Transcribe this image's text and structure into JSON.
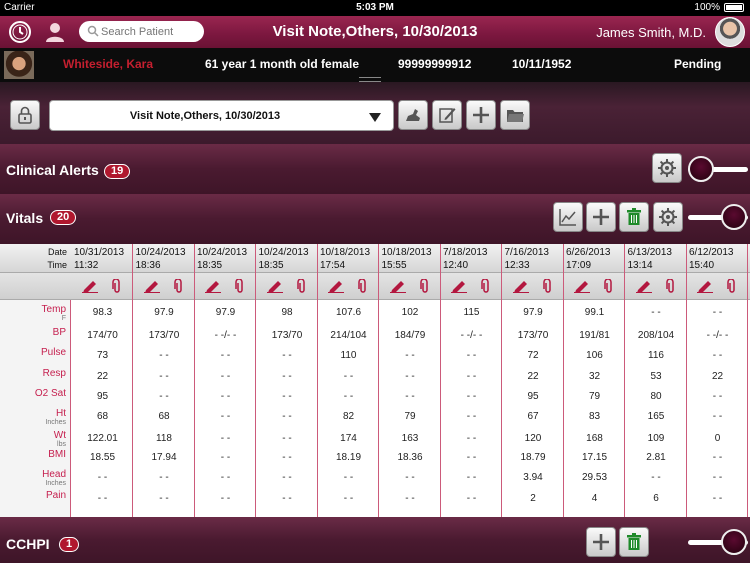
{
  "status_bar": {
    "carrier": "Carrier",
    "time": "5:03 PM",
    "battery": "100%"
  },
  "nav": {
    "search_placeholder": "Search Patient",
    "title": "Visit Note,Others, 10/30/2013",
    "user": "James Smith, M.D."
  },
  "patient": {
    "name": "Whiteside, Kara",
    "age_sex": "61 year 1 month old female",
    "id": "99999999912",
    "dob": "10/11/1952",
    "status": "Pending"
  },
  "toolbar": {
    "note_selected": "Visit Note,Others, 10/30/2013"
  },
  "sections": {
    "clinical_alerts": {
      "title": "Clinical Alerts",
      "count": "19"
    },
    "vitals": {
      "title": "Vitals",
      "count": "20"
    },
    "cchpi": {
      "title": "CCHPI",
      "count": "1"
    }
  },
  "vitals_table": {
    "header": {
      "date": "Date",
      "time": "Time"
    },
    "rows": [
      {
        "label": "Temp",
        "unit": "F"
      },
      {
        "label": "BP",
        "unit": ""
      },
      {
        "label": "Pulse",
        "unit": ""
      },
      {
        "label": "Resp",
        "unit": ""
      },
      {
        "label": "O2 Sat",
        "unit": ""
      },
      {
        "label": "Ht",
        "unit": "Inches"
      },
      {
        "label": "Wt",
        "unit": "lbs"
      },
      {
        "label": "BMI",
        "unit": ""
      },
      {
        "label": "Head",
        "unit": "Inches"
      },
      {
        "label": "Pain",
        "unit": ""
      }
    ],
    "columns": [
      {
        "date": "10/31/2013",
        "time": "11:32",
        "values": [
          "98.3",
          "174/70",
          "73",
          "22",
          "95",
          "68",
          "122.01",
          "18.55",
          "- -",
          "- -"
        ]
      },
      {
        "date": "10/24/2013",
        "time": "18:36",
        "values": [
          "97.9",
          "173/70",
          "- -",
          "- -",
          "- -",
          "68",
          "118",
          "17.94",
          "- -",
          "- -"
        ]
      },
      {
        "date": "10/24/2013",
        "time": "18:35",
        "values": [
          "97.9",
          "- -/- -",
          "- -",
          "- -",
          "- -",
          "- -",
          "- -",
          "- -",
          "- -",
          "- -"
        ]
      },
      {
        "date": "10/24/2013",
        "time": "18:35",
        "values": [
          "98",
          "173/70",
          "- -",
          "- -",
          "- -",
          "- -",
          "- -",
          "- -",
          "- -",
          "- -"
        ]
      },
      {
        "date": "10/18/2013",
        "time": "17:54",
        "values": [
          "107.6",
          "214/104",
          "110",
          "- -",
          "- -",
          "82",
          "174",
          "18.19",
          "- -",
          "- -"
        ]
      },
      {
        "date": "10/18/2013",
        "time": "15:55",
        "values": [
          "102",
          "184/79",
          "- -",
          "- -",
          "- -",
          "79",
          "163",
          "18.36",
          "- -",
          "- -"
        ]
      },
      {
        "date": "7/18/2013",
        "time": "12:40",
        "values": [
          "115",
          "- -/- -",
          "- -",
          "- -",
          "- -",
          "- -",
          "- -",
          "- -",
          "- -",
          "- -"
        ]
      },
      {
        "date": "7/16/2013",
        "time": "12:33",
        "values": [
          "97.9",
          "173/70",
          "72",
          "22",
          "95",
          "67",
          "120",
          "18.79",
          "3.94",
          "2"
        ]
      },
      {
        "date": "6/26/2013",
        "time": "17:09",
        "values": [
          "99.1",
          "191/81",
          "106",
          "32",
          "79",
          "83",
          "168",
          "17.15",
          "29.53",
          "4"
        ]
      },
      {
        "date": "6/13/2013",
        "time": "13:14",
        "values": [
          "- -",
          "208/104",
          "116",
          "53",
          "80",
          "165",
          "109",
          "2.81",
          "- -",
          "6"
        ]
      },
      {
        "date": "6/12/2013",
        "time": "15:40",
        "values": [
          "- -",
          "- -/- -",
          "- -",
          "22",
          "- -",
          "- -",
          "0",
          "- -",
          "- -",
          "- -"
        ]
      }
    ]
  },
  "colors": {
    "accent": "#7d1840",
    "alert_red": "#c51f2f",
    "badge": "#b0172e"
  }
}
